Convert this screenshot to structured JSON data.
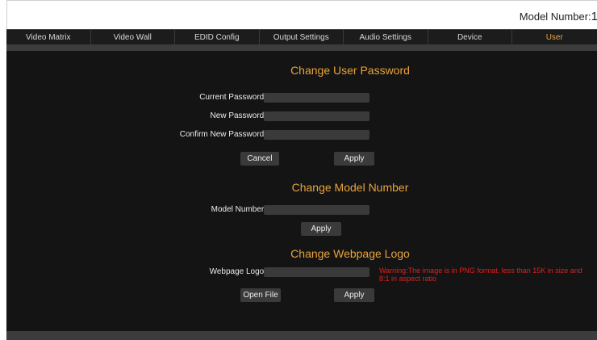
{
  "header": {
    "model_label": "Model Number:",
    "model_value": "1"
  },
  "nav": {
    "tabs": [
      "Video Matrix",
      "Video Wall",
      "EDID Config",
      "Output Settings",
      "Audio Settings",
      "Device",
      "User"
    ],
    "active": "User"
  },
  "password_section": {
    "title": "Change User Password",
    "current_label": "Current Password:",
    "new_label": "New Password:",
    "confirm_label": "Confirm New Password:",
    "cancel_label": "Cancel",
    "apply_label": "Apply"
  },
  "model_section": {
    "title": "Change Model Number",
    "model_label": "Model Number:",
    "apply_label": "Apply"
  },
  "logo_section": {
    "title": "Change Webpage Logo",
    "logo_label": "Webpage Logo:",
    "warning": "Warning:The image is in PNG format, less than 15K in size and 8:1 in aspect ratio",
    "open_label": "Open File",
    "apply_label": "Apply"
  },
  "colors": {
    "accent": "#e8a33a",
    "warning": "#e02020",
    "background": "#141414"
  }
}
